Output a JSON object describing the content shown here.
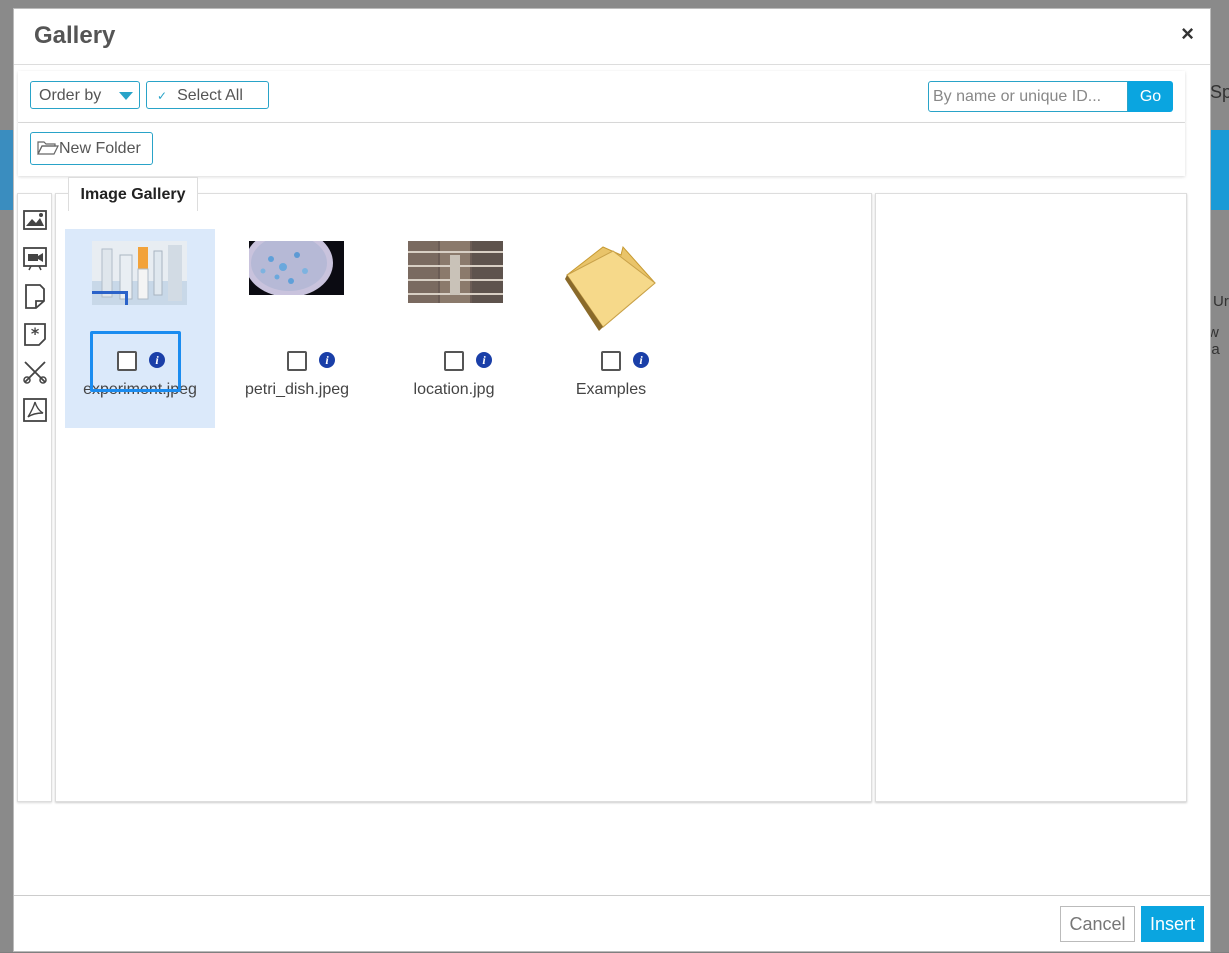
{
  "dialog": {
    "title": "Gallery",
    "close_label": "×"
  },
  "toolbar": {
    "order_by_label": "Order by",
    "select_all_label": "Select All",
    "search_placeholder": "By name or unique ID...",
    "go_label": "Go",
    "new_folder_label": "New Folder"
  },
  "gallery_tab": {
    "label": "Image Gallery"
  },
  "rail": {
    "icons": [
      "image-icon",
      "video-icon",
      "document-icon",
      "snippet-icon",
      "tools-icon",
      "pdf-icon"
    ]
  },
  "items": [
    {
      "label": "experiment.jpeg",
      "type": "image",
      "selected": true
    },
    {
      "label": "petri_dish.jpeg",
      "type": "image",
      "selected": false
    },
    {
      "label": "location.jpg",
      "type": "image",
      "selected": false
    },
    {
      "label": "Examples",
      "type": "folder",
      "selected": false
    }
  ],
  "footer": {
    "cancel_label": "Cancel",
    "insert_label": "Insert"
  },
  "background": {
    "text_right": "Sp",
    "text_right2": "Ur",
    "text_right3": "w la"
  },
  "colors": {
    "accent": "#0aa5e0",
    "border_accent": "#29a3c8",
    "selected_bg": "#dbe9fa",
    "focus": "#1a8cf0"
  }
}
